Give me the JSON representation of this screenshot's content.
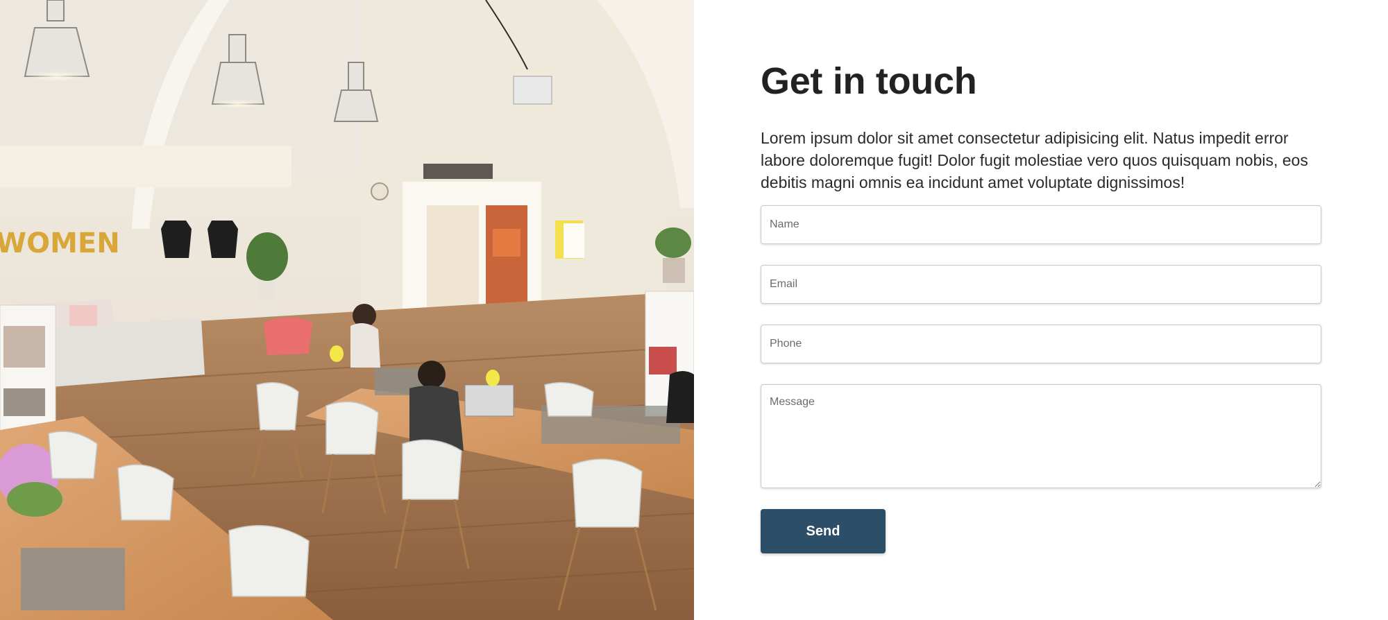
{
  "hero_image": {
    "description": "coworking-office-photo",
    "banner_text": "WOMEN"
  },
  "contact": {
    "title": "Get in touch",
    "intro": "Lorem ipsum dolor sit amet consectetur adipisicing elit. Natus impedit error labore doloremque fugit! Dolor fugit molestiae vero quos quisquam nobis, eos debitis magni omnis ea incidunt amet voluptate dignissimos!",
    "fields": {
      "name": {
        "placeholder": "Name",
        "value": ""
      },
      "email": {
        "placeholder": "Email",
        "value": ""
      },
      "phone": {
        "placeholder": "Phone",
        "value": ""
      },
      "message": {
        "placeholder": "Message",
        "value": ""
      }
    },
    "send_label": "Send"
  },
  "colors": {
    "button_bg": "#2d4e67",
    "button_text": "#ffffff",
    "heading": "#222222"
  }
}
